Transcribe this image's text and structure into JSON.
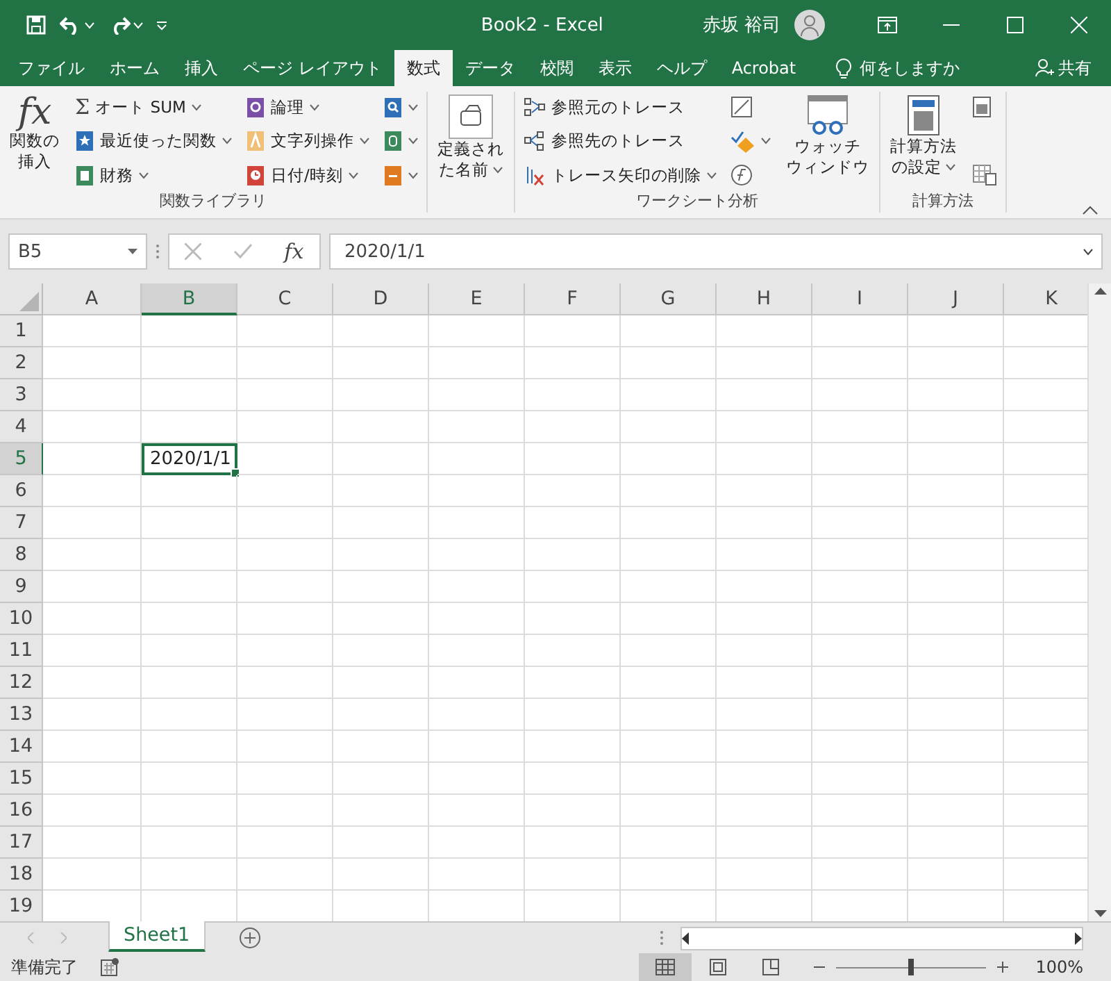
{
  "title_bar": {
    "title": "Book2  -  Excel",
    "user": "赤坂 裕司"
  },
  "tabs": [
    {
      "label": "ファイル",
      "selected": false
    },
    {
      "label": "ホーム",
      "selected": false
    },
    {
      "label": "挿入",
      "selected": false
    },
    {
      "label": "ページ レイアウト",
      "selected": false
    },
    {
      "label": "数式",
      "selected": true
    },
    {
      "label": "データ",
      "selected": false
    },
    {
      "label": "校閲",
      "selected": false
    },
    {
      "label": "表示",
      "selected": false
    },
    {
      "label": "ヘルプ",
      "selected": false
    },
    {
      "label": "Acrobat",
      "selected": false
    }
  ],
  "tell_me": "何をしますか",
  "share": "共有",
  "ribbon": {
    "groups": [
      {
        "label": "関数ライブラリ",
        "columns": [
          [
            {
              "kind": "large",
              "glyph": "fx",
              "label": [
                "関数の",
                "挿入"
              ],
              "dropdown": false
            }
          ],
          [
            {
              "kind": "small",
              "glyph": "Σ",
              "label": "オート SUM",
              "dropdown": true
            },
            {
              "kind": "small",
              "label": "最近使った関数",
              "dropdown": true
            },
            {
              "kind": "small",
              "label": "財務",
              "dropdown": true
            }
          ],
          [
            {
              "kind": "small",
              "label": "論理",
              "dropdown": true
            },
            {
              "kind": "small",
              "label": "文字列操作",
              "dropdown": true
            },
            {
              "kind": "small",
              "label": "日付/時刻",
              "dropdown": true
            }
          ],
          [
            {
              "kind": "icon",
              "dropdown": true
            },
            {
              "kind": "icon",
              "dropdown": true
            },
            {
              "kind": "icon",
              "dropdown": true
            }
          ]
        ]
      },
      {
        "columns": [
          [
            {
              "kind": "large",
              "label": [
                "定義され",
                "た名前"
              ],
              "dropdown": true
            }
          ]
        ]
      },
      {
        "label": "ワークシート分析",
        "columns": [
          [
            {
              "kind": "small",
              "label": "参照元のトレース",
              "dropdown": false
            },
            {
              "kind": "small",
              "label": "参照先のトレース",
              "dropdown": false
            },
            {
              "kind": "small",
              "label": "トレース矢印の削除",
              "dropdown": true
            }
          ],
          [
            {
              "kind": "icon",
              "dropdown": false
            },
            {
              "kind": "icon",
              "dropdown": true
            },
            {
              "kind": "icon",
              "dropdown": false
            }
          ],
          [
            {
              "kind": "large",
              "label": [
                "ウォッチ",
                "ウィンドウ"
              ],
              "dropdown": false
            }
          ]
        ]
      },
      {
        "label": "計算方法",
        "columns": [
          [
            {
              "kind": "large",
              "label": [
                "計算方法",
                "の設定"
              ],
              "dropdown": true
            }
          ],
          [
            {
              "kind": "icon",
              "dropdown": false
            },
            {
              "kind": "icon",
              "dropdown": false
            }
          ]
        ]
      }
    ]
  },
  "name_box": "B5",
  "formula_glyph": "fx",
  "formula": "2020/1/1",
  "columns": [
    {
      "label": "A",
      "selected": false
    },
    {
      "label": "B",
      "selected": true
    },
    {
      "label": "C",
      "selected": false
    },
    {
      "label": "D",
      "selected": false
    },
    {
      "label": "E",
      "selected": false
    },
    {
      "label": "F",
      "selected": false
    },
    {
      "label": "G",
      "selected": false
    },
    {
      "label": "H",
      "selected": false
    },
    {
      "label": "I",
      "selected": false
    },
    {
      "label": "J",
      "selected": false
    },
    {
      "label": "K",
      "selected": false
    }
  ],
  "rows": [
    {
      "label": "1",
      "selected": false
    },
    {
      "label": "2",
      "selected": false
    },
    {
      "label": "3",
      "selected": false
    },
    {
      "label": "4",
      "selected": false
    },
    {
      "label": "5",
      "selected": true,
      "cells": [
        {
          "kind": "empty"
        },
        {
          "kind": "value",
          "value": "2020/1/1",
          "selected": true
        }
      ]
    },
    {
      "label": "6",
      "selected": false
    },
    {
      "label": "7",
      "selected": false
    },
    {
      "label": "8",
      "selected": false
    },
    {
      "label": "9",
      "selected": false
    },
    {
      "label": "10",
      "selected": false
    },
    {
      "label": "11",
      "selected": false
    },
    {
      "label": "12",
      "selected": false
    },
    {
      "label": "13",
      "selected": false
    },
    {
      "label": "14",
      "selected": false
    },
    {
      "label": "15",
      "selected": false
    },
    {
      "label": "16",
      "selected": false
    },
    {
      "label": "17",
      "selected": false
    },
    {
      "label": "18",
      "selected": false
    },
    {
      "label": "19",
      "selected": false
    }
  ],
  "sheets": [
    {
      "label": "Sheet1",
      "selected": true
    }
  ],
  "status_bar": {
    "status": "準備完了",
    "zoom": {
      "level": 0.5,
      "reading": "100%"
    }
  }
}
